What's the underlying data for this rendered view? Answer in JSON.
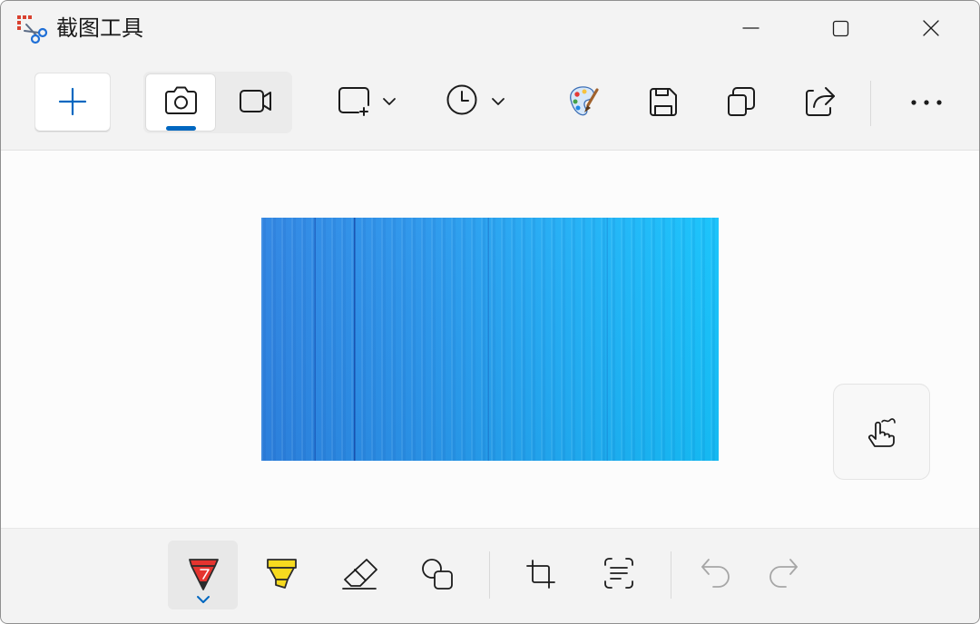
{
  "window": {
    "title": "截图工具",
    "app_icon": "snipping-tool-icon",
    "minimize_icon": "minimize-icon",
    "maximize_icon": "maximize-icon",
    "close_icon": "close-icon"
  },
  "toolbar": {
    "new_icon": "plus-icon",
    "capture_modes": [
      {
        "icon": "camera-icon",
        "selected": true
      },
      {
        "icon": "video-camera-icon",
        "selected": false
      }
    ],
    "snip_shape": {
      "icon": "rectangle-snip-icon",
      "dropdown_icon": "chevron-down-icon"
    },
    "delay": {
      "icon": "clock-icon",
      "dropdown_icon": "chevron-down-icon"
    },
    "actions": [
      {
        "icon": "paint-palette-icon"
      },
      {
        "icon": "save-icon"
      },
      {
        "icon": "copy-icon"
      },
      {
        "icon": "share-icon"
      }
    ],
    "more_icon": "more-dots-icon"
  },
  "canvas": {
    "touch_writing_icon": "touch-writing-hand-icon"
  },
  "markup_toolbar": {
    "tools": [
      {
        "icon": "ballpoint-pen-icon",
        "selected": true,
        "dropdown_icon": "chevron-down-icon"
      },
      {
        "icon": "highlighter-icon",
        "selected": false
      },
      {
        "icon": "eraser-icon",
        "selected": false
      },
      {
        "icon": "shapes-icon",
        "selected": false
      }
    ],
    "crop_icon": "crop-icon",
    "text_actions_icon": "text-actions-icon",
    "undo": {
      "icon": "undo-icon",
      "disabled": true
    },
    "redo": {
      "icon": "redo-icon",
      "disabled": true
    }
  },
  "colors": {
    "accent": "#0067c0",
    "chrome": "#f3f3f3",
    "canvas": "#fcfcfc",
    "icon": "#1b1b1b",
    "disabled_icon": "#a6a6a6",
    "pen": "#e5342f",
    "highlighter": "#f7da1f",
    "image_left": "#2e85e3",
    "image_right": "#16c3fb"
  }
}
